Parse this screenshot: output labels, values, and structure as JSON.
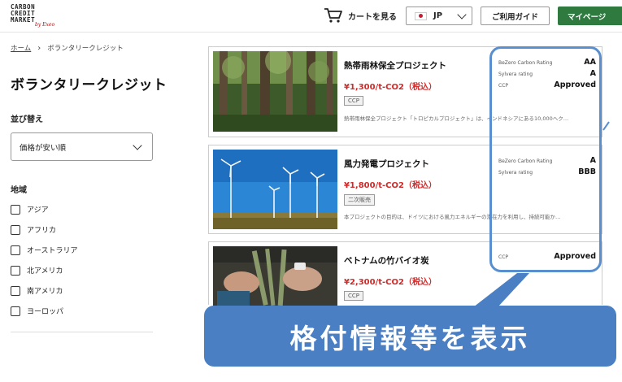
{
  "header": {
    "logo_line1": "CARBON",
    "logo_line2": "CREDIT",
    "logo_line3": "MARKET",
    "logo_script": "by Exeo",
    "cart_label": "カートを見る",
    "lang_value": "JP",
    "guide_label": "ご利用ガイド",
    "mypage_label": "マイページ"
  },
  "breadcrumb": {
    "home": "ホーム",
    "current": "ボランタリークレジット"
  },
  "page_title": "ボランタリークレジット",
  "sort": {
    "label": "並び替え",
    "selected": "価格が安い順"
  },
  "region": {
    "label": "地域",
    "items": [
      "アジア",
      "アフリカ",
      "オーストラリア",
      "北アメリカ",
      "南アメリカ",
      "ヨーロッパ"
    ]
  },
  "products": [
    {
      "name": "熱帯雨林保全プロジェクト",
      "price": "¥1,300/t-CO2（税込）",
      "tag": "CCP",
      "desc": "熱帯雨林保全プロジェクト「トロピカルプロジェクト」は、インドネシアにある10,000ヘク…",
      "ratings": [
        {
          "label": "BeZero Carbon Rating",
          "value": "AA"
        },
        {
          "label": "Sylvera rating",
          "value": "A"
        },
        {
          "label": "CCP",
          "value": "Approved"
        }
      ]
    },
    {
      "name": "風力発電プロジェクト",
      "price": "¥1,800/t-CO2（税込）",
      "tag": "二次販売",
      "desc": "本プロジェクトの目的は、ドイツにおける風力エネルギーの潜在力を利用し、持続可能か…",
      "ratings": [
        {
          "label": "BeZero Carbon Rating",
          "value": "A"
        },
        {
          "label": "Sylvera rating",
          "value": "BBB"
        }
      ]
    },
    {
      "name": "ベトナムの竹バイオ炭",
      "price": "¥2,300/t-CO2（税込）",
      "tag": "CCP",
      "desc": "",
      "ratings": [
        {
          "label": "CCP",
          "value": "Approved"
        }
      ]
    }
  ],
  "banner_text": "格付情報等を表示",
  "colors": {
    "accent_green": "#2e7a3f",
    "price_red": "#d02a2a",
    "callout_blue": "#4a7fc4"
  }
}
